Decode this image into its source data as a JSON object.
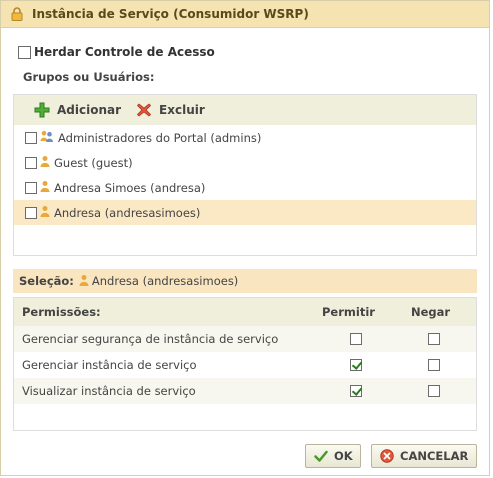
{
  "dialog": {
    "title": "Instância de Serviço (Consumidor WSRP)"
  },
  "inherit": {
    "label": "Herdar Controle de Acesso",
    "checked": false
  },
  "groups": {
    "label": "Grupos ou Usuários:",
    "toolbar": {
      "add_label": "Adicionar",
      "delete_label": "Excluir"
    },
    "members": [
      {
        "name": "Administradores do Portal (admins)",
        "type": "group",
        "checked": false,
        "selected": false
      },
      {
        "name": "Guest (guest)",
        "type": "user",
        "checked": false,
        "selected": false
      },
      {
        "name": "Andresa Simoes (andresa)",
        "type": "user",
        "checked": false,
        "selected": false
      },
      {
        "name": "Andresa (andresasimoes)",
        "type": "user",
        "checked": false,
        "selected": true
      }
    ]
  },
  "selection": {
    "label": "Seleção:",
    "value": "Andresa (andresasimoes)"
  },
  "permissions": {
    "headers": {
      "name": "Permissões:",
      "allow": "Permitir",
      "deny": "Negar"
    },
    "rows": [
      {
        "name": "Gerenciar segurança de instância de serviço",
        "allow": false,
        "deny": false
      },
      {
        "name": "Gerenciar instância de serviço",
        "allow": true,
        "deny": false
      },
      {
        "name": "Visualizar instância de serviço",
        "allow": true,
        "deny": false
      }
    ]
  },
  "buttons": {
    "ok_label": "OK",
    "cancel_label": "CANCELAR"
  },
  "colors": {
    "title_bar": "#f5e3b2",
    "toolbar_bg": "#f0efdb",
    "selected_row": "#fbe8c5",
    "add_icon": "#3a9a2a",
    "delete_icon": "#d8452a"
  }
}
